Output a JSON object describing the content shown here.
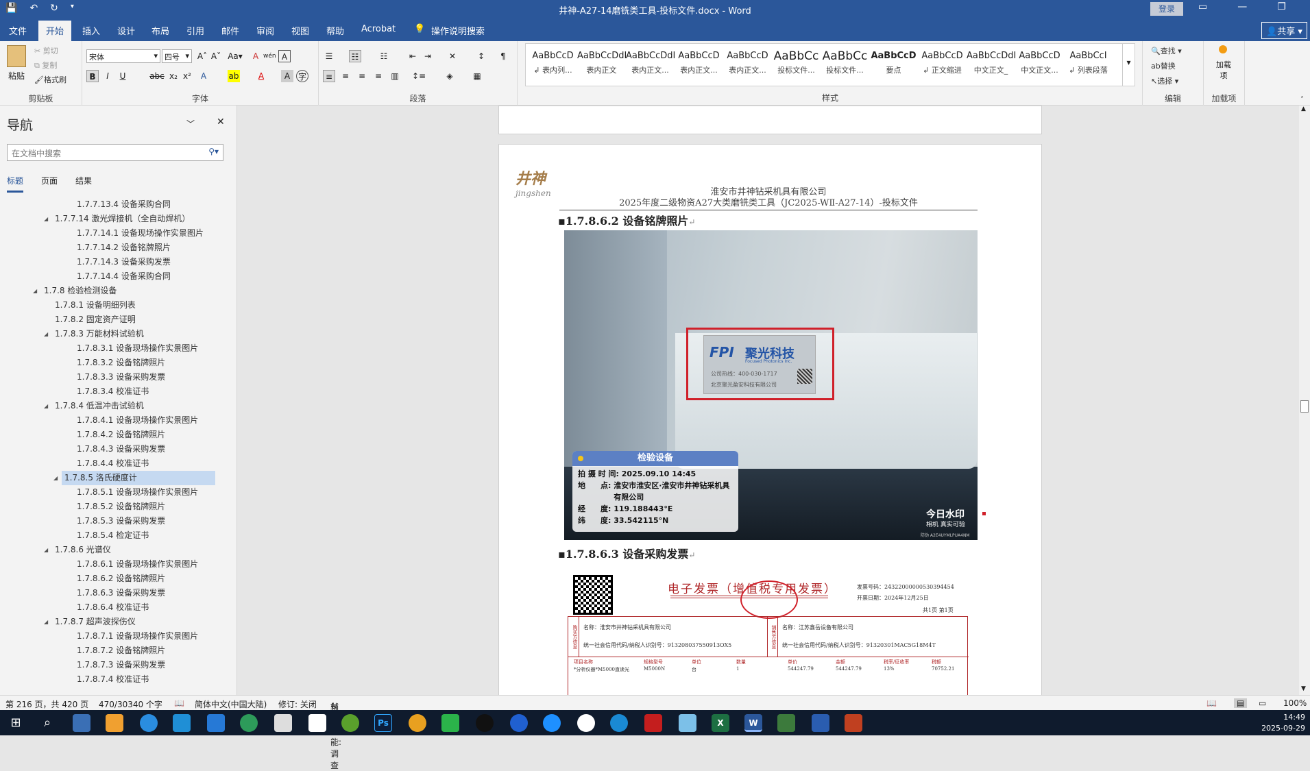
{
  "titlebar": {
    "title": "井神-A27-14磨铣类工具-投标文件.docx - Word",
    "login": "登录",
    "save_icon": "save-icon",
    "undo_icon": "undo-icon",
    "redo_icon": "redo-icon"
  },
  "tabs": [
    "文件",
    "开始",
    "插入",
    "设计",
    "布局",
    "引用",
    "邮件",
    "审阅",
    "视图",
    "帮助",
    "Acrobat",
    "操作说明搜索"
  ],
  "share": "共享",
  "ribbon": {
    "clipboard": {
      "paste": "粘贴",
      "cut": "剪切",
      "copy": "复制",
      "painter": "格式刷",
      "label": "剪贴板"
    },
    "font": {
      "name": "宋体",
      "size": "四号",
      "label": "字体"
    },
    "paragraph": {
      "label": "段落"
    },
    "styles": {
      "label": "样式",
      "items": [
        {
          "preview": "AaBbCcD",
          "name": "↲ 表内列..."
        },
        {
          "preview": "AaBbCcDdI",
          "name": "表内正文"
        },
        {
          "preview": "AaBbCcDdI",
          "name": "表内正文..."
        },
        {
          "preview": "AaBbCcD",
          "name": "表内正文..."
        },
        {
          "preview": "AaBbCcD",
          "name": "表内正文..."
        },
        {
          "preview": "AaBbCc",
          "name": "投标文件..."
        },
        {
          "preview": "AaBbCc",
          "name": "投标文件..."
        },
        {
          "preview": "AaBbCcD",
          "name": "要点"
        },
        {
          "preview": "AaBbCcD",
          "name": "↲ 正文缩进"
        },
        {
          "preview": "AaBbCcDdI",
          "name": "中文正文_"
        },
        {
          "preview": "AaBbCcD",
          "name": "中文正文..."
        },
        {
          "preview": "AaBbCcI",
          "name": "↲ 列表段落"
        }
      ]
    },
    "editing": {
      "find": "查找",
      "replace": "替换",
      "select": "选择",
      "label": "编辑"
    },
    "addins": {
      "btn": "加载项",
      "label": "加载项"
    }
  },
  "nav": {
    "title": "导航",
    "search_placeholder": "在文档中搜索",
    "tabs": [
      "标题",
      "页面",
      "结果"
    ],
    "items": [
      {
        "level": 4,
        "text": "1.7.7.13.4 设备采购合同",
        "arrow": ""
      },
      {
        "level": 3,
        "text": "1.7.7.14 激光焊接机（全自动焊机）",
        "arrow": "◢"
      },
      {
        "level": 4,
        "text": "1.7.7.14.1 设备现场操作实景图片",
        "arrow": ""
      },
      {
        "level": 4,
        "text": "1.7.7.14.2 设备铭牌照片",
        "arrow": ""
      },
      {
        "level": 4,
        "text": "1.7.7.14.3 设备采购发票",
        "arrow": ""
      },
      {
        "level": 4,
        "text": "1.7.7.14.4 设备采购合同",
        "arrow": ""
      },
      {
        "level": 2,
        "text": "1.7.8 检验检测设备",
        "arrow": "◢"
      },
      {
        "level": 3,
        "text": "1.7.8.1 设备明细列表",
        "arrow": ""
      },
      {
        "level": 3,
        "text": "1.7.8.2 固定资产证明",
        "arrow": ""
      },
      {
        "level": 3,
        "text": "1.7.8.3 万能材料试验机",
        "arrow": "◢"
      },
      {
        "level": 4,
        "text": "1.7.8.3.1 设备现场操作实景图片",
        "arrow": ""
      },
      {
        "level": 4,
        "text": "1.7.8.3.2 设备铭牌照片",
        "arrow": ""
      },
      {
        "level": 4,
        "text": "1.7.8.3.3 设备采购发票",
        "arrow": ""
      },
      {
        "level": 4,
        "text": "1.7.8.3.4 校准证书",
        "arrow": ""
      },
      {
        "level": 3,
        "text": "1.7.8.4 低温冲击试验机",
        "arrow": "◢"
      },
      {
        "level": 4,
        "text": "1.7.8.4.1 设备现场操作实景图片",
        "arrow": ""
      },
      {
        "level": 4,
        "text": "1.7.8.4.2 设备铭牌照片",
        "arrow": ""
      },
      {
        "level": 4,
        "text": "1.7.8.4.3 设备采购发票",
        "arrow": ""
      },
      {
        "level": 4,
        "text": "1.7.8.4.4 校准证书",
        "arrow": ""
      },
      {
        "level": 3,
        "text": "1.7.8.5 洛氏硬度计",
        "arrow": "◢",
        "selected": true
      },
      {
        "level": 4,
        "text": "1.7.8.5.1 设备现场操作实景图片",
        "arrow": ""
      },
      {
        "level": 4,
        "text": "1.7.8.5.2 设备铭牌照片",
        "arrow": ""
      },
      {
        "level": 4,
        "text": "1.7.8.5.3 设备采购发票",
        "arrow": ""
      },
      {
        "level": 4,
        "text": "1.7.8.5.4 检定证书",
        "arrow": ""
      },
      {
        "level": 3,
        "text": "1.7.8.6 光谱仪",
        "arrow": "◢"
      },
      {
        "level": 4,
        "text": "1.7.8.6.1 设备现场操作实景图片",
        "arrow": ""
      },
      {
        "level": 4,
        "text": "1.7.8.6.2 设备铭牌照片",
        "arrow": ""
      },
      {
        "level": 4,
        "text": "1.7.8.6.3 设备采购发票",
        "arrow": ""
      },
      {
        "level": 4,
        "text": "1.7.8.6.4 校准证书",
        "arrow": ""
      },
      {
        "level": 3,
        "text": "1.7.8.7 超声波探伤仪",
        "arrow": "◢"
      },
      {
        "level": 4,
        "text": "1.7.8.7.1 设备现场操作实景图片",
        "arrow": ""
      },
      {
        "level": 4,
        "text": "1.7.8.7.2 设备铭牌照片",
        "arrow": ""
      },
      {
        "level": 4,
        "text": "1.7.8.7.3 设备采购发票",
        "arrow": ""
      },
      {
        "level": 4,
        "text": "1.7.8.7.4 校准证书",
        "arrow": ""
      }
    ]
  },
  "doc": {
    "logo_cn": "井神",
    "logo_en": "jingshen",
    "header_line1": "淮安市井神钻采机具有限公司",
    "header_line2": "2025年度二级物资A27大类磨铣类工具（JC2025-WⅡ-A27-14）-投标文件",
    "heading1": "1.7.8.6.2 设备铭牌照片",
    "heading2": "1.7.8.6.3 设备采购发票",
    "photo": {
      "brand_logo": "FPI",
      "brand_cn": "聚光科技",
      "brand_en": "Focused Photonics Inc.",
      "phone": "公司热线：400-030-1717",
      "company": "北京聚光盈安科技有限公司",
      "wm_title": "检验设备",
      "wm_time_label": "拍 摄 时 间:",
      "wm_time": "2025.09.10 14:45",
      "wm_place_label": "地　　点:",
      "wm_place": "淮安市淮安区·淮安市井神钻采机具有限公司",
      "wm_lon_label": "经　　度:",
      "wm_lon": "119.188443°E",
      "wm_lat_label": "纬　　度:",
      "wm_lat": "33.542115°N",
      "app": "今日水印",
      "app_sub": "相机 真实可验",
      "code": "防伪 A2E4UYMLPUA4NM"
    },
    "invoice": {
      "title": "电子发票（增值税专用发票）",
      "number": "发票号码：24322000000530394454",
      "date": "开票日期：2024年12月25日",
      "pages": "共1页 第1页",
      "buyer_name": "名称：淮安市井神钻采机具有限公司",
      "buyer_id": "统一社会信用代码/纳税人识别号：913208037550913OX5",
      "seller_name": "名称：江苏鑫岳设备有限公司",
      "seller_id": "统一社会信用代码/纳税人识别号：91320301MAC5G18M4T",
      "buyer_tag": "购买方信息",
      "seller_tag": "销售方信息",
      "cols": [
        "项目名称",
        "规格型号",
        "单位",
        "数量",
        "单价",
        "金额",
        "税率/征收率",
        "税额"
      ],
      "row": [
        "*分析仪器*M5000直读光",
        "M5000N",
        "台",
        "1",
        "544247.79",
        "544247.79",
        "13%",
        "70752.21"
      ]
    }
  },
  "status": {
    "page": "第 216 页，共 420 页",
    "words": "470/30340 个字",
    "lang": "简体中文(中国大陆)",
    "track": "修订: 关闭",
    "access": "辅助功能: 调查",
    "zoom": "100%"
  },
  "clock": {
    "time": "14:49",
    "date": "2025-09-29"
  },
  "colors": {
    "word_blue": "#2b579a",
    "invoice_red": "#b0282a",
    "highlight_red": "#d0202a"
  }
}
